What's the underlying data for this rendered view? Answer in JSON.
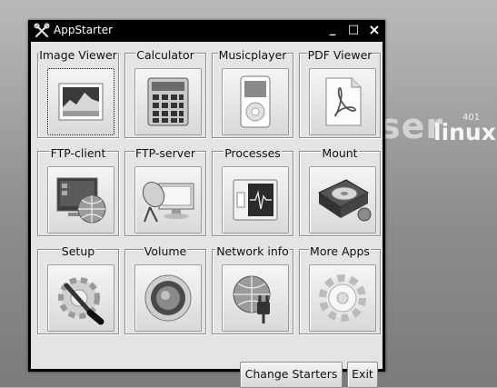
{
  "window": {
    "title": "AppStarter",
    "minimize_glyph": "_",
    "maximize_glyph": "□",
    "close_glyph": "×"
  },
  "desktop": {
    "brand_ser": "ser",
    "brand_linux": "linux",
    "brand_version": "401"
  },
  "starters": [
    {
      "label": "Image Viewer",
      "icon": "image-viewer-icon",
      "selected": true
    },
    {
      "label": "Calculator",
      "icon": "calculator-icon"
    },
    {
      "label": "Musicplayer",
      "icon": "music-player-icon"
    },
    {
      "label": "PDF Viewer",
      "icon": "pdf-viewer-icon"
    },
    {
      "label": "FTP-client",
      "icon": "ftp-client-icon"
    },
    {
      "label": "FTP-server",
      "icon": "ftp-server-icon"
    },
    {
      "label": "Processes",
      "icon": "processes-icon"
    },
    {
      "label": "Mount",
      "icon": "mount-icon"
    },
    {
      "label": "Setup",
      "icon": "setup-icon"
    },
    {
      "label": "Volume",
      "icon": "volume-icon"
    },
    {
      "label": "Network info",
      "icon": "network-info-icon"
    },
    {
      "label": "More Apps",
      "icon": "more-apps-icon"
    }
  ],
  "buttons": {
    "change_starters": "Change Starters",
    "exit": "Exit"
  }
}
